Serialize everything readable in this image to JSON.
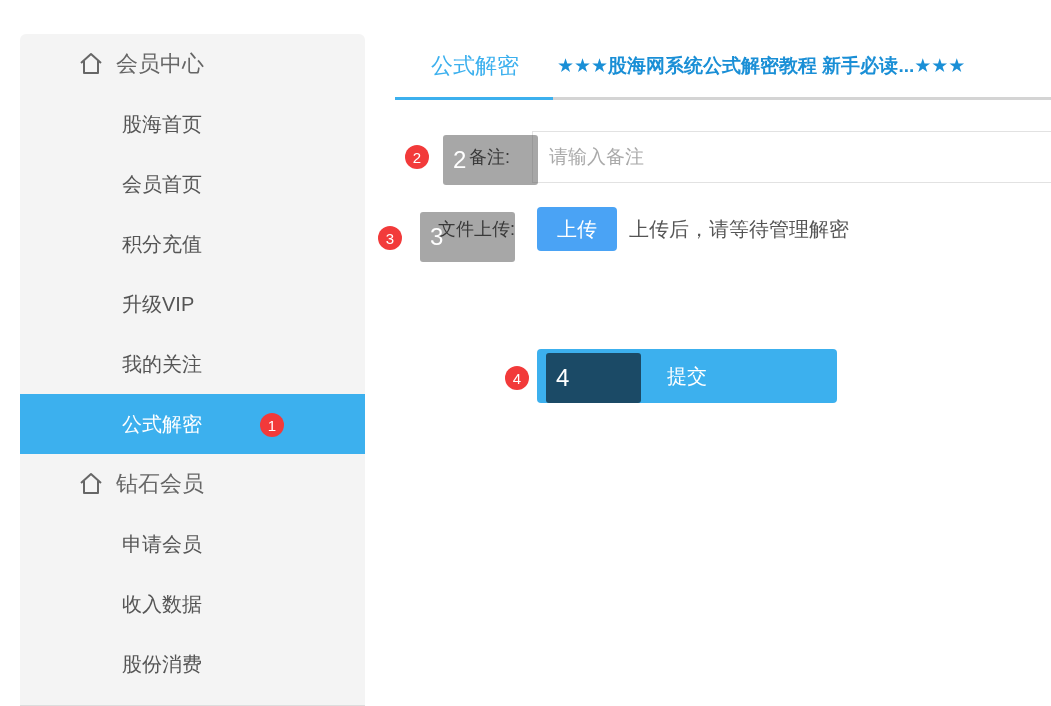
{
  "sidebar": {
    "groups": [
      {
        "title": "会员中心",
        "items": [
          {
            "label": "股海首页",
            "selected": false
          },
          {
            "label": "会员首页",
            "selected": false
          },
          {
            "label": "积分充值",
            "selected": false
          },
          {
            "label": "升级VIP",
            "selected": false
          },
          {
            "label": "我的关注",
            "selected": false
          },
          {
            "label": "公式解密",
            "selected": true,
            "marker": "1"
          }
        ]
      },
      {
        "title": "钻石会员",
        "items": [
          {
            "label": "申请会员",
            "selected": false
          },
          {
            "label": "收入数据",
            "selected": false
          },
          {
            "label": "股份消费",
            "selected": false
          }
        ]
      }
    ]
  },
  "tabs": [
    {
      "label": "公式解密",
      "selected": true
    },
    {
      "label": "★★★股海网系统公式解密教程 新手必读...★★★",
      "selected": false
    }
  ],
  "form": {
    "note": {
      "label": "备注:",
      "placeholder": "请输入备注",
      "marker": "2",
      "callout": "2"
    },
    "upload": {
      "label": "文件上传:",
      "button": "上传",
      "hint": "上传后，请等待管理解密",
      "marker": "3",
      "callout": "3"
    },
    "submit": {
      "label": "提交",
      "marker": "4",
      "callout": "4"
    }
  }
}
